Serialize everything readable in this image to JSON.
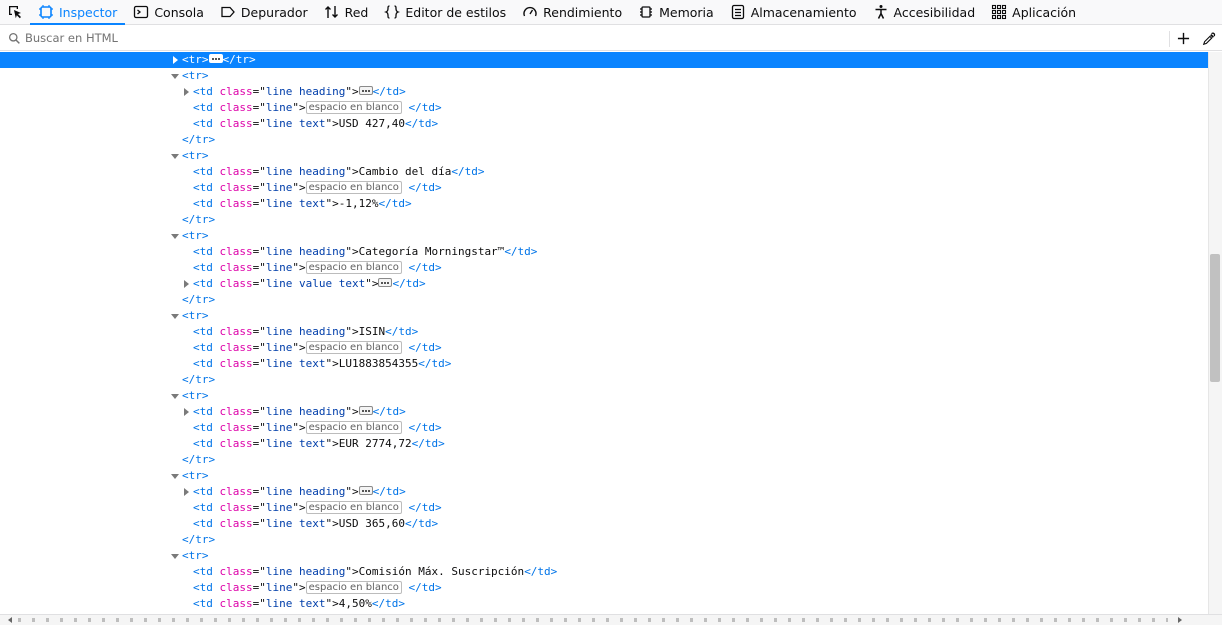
{
  "toolbar": {
    "tabs": [
      {
        "label": "Inspector",
        "icon": "inspector-icon",
        "selected": true
      },
      {
        "label": "Consola",
        "icon": "console-icon"
      },
      {
        "label": "Depurador",
        "icon": "debugger-icon"
      },
      {
        "label": "Red",
        "icon": "network-icon"
      },
      {
        "label": "Editor de estilos",
        "icon": "style-editor-icon"
      },
      {
        "label": "Rendimiento",
        "icon": "performance-icon"
      },
      {
        "label": "Memoria",
        "icon": "memory-icon"
      },
      {
        "label": "Almacenamiento",
        "icon": "storage-icon"
      },
      {
        "label": "Accesibilidad",
        "icon": "accessibility-icon"
      },
      {
        "label": "Aplicación",
        "icon": "application-icon"
      }
    ],
    "accent_color": "#0a84ff"
  },
  "search": {
    "placeholder": "Buscar en HTML"
  },
  "markup": {
    "whitespace_label": "espacio en blanco",
    "colors": {
      "tag": "#0074e8",
      "attr_name": "#dd00a9",
      "attr_value": "#003eaa",
      "selection": "#0a84ff"
    },
    "nodes": [
      {
        "kind": "tr_collapsed",
        "depth": 0,
        "selected": true
      },
      {
        "kind": "tr_open",
        "depth": 0
      },
      {
        "kind": "td",
        "depth": 1,
        "cls": "line heading",
        "content": "",
        "collapsed": true
      },
      {
        "kind": "td_ws",
        "depth": 1,
        "cls": "line"
      },
      {
        "kind": "td",
        "depth": 1,
        "cls": "line text",
        "content": "USD 427,40"
      },
      {
        "kind": "tr_close",
        "depth": 0
      },
      {
        "kind": "tr_open",
        "depth": 0
      },
      {
        "kind": "td",
        "depth": 1,
        "cls": "line heading",
        "content": "Cambio del día"
      },
      {
        "kind": "td_ws",
        "depth": 1,
        "cls": "line"
      },
      {
        "kind": "td",
        "depth": 1,
        "cls": "line text",
        "content": "-1,12%"
      },
      {
        "kind": "tr_close",
        "depth": 0
      },
      {
        "kind": "tr_open",
        "depth": 0
      },
      {
        "kind": "td",
        "depth": 1,
        "cls": "line heading",
        "content": "Categoría Morningstar™"
      },
      {
        "kind": "td_ws",
        "depth": 1,
        "cls": "line"
      },
      {
        "kind": "td",
        "depth": 1,
        "cls": "line value text",
        "content": "",
        "collapsed": true
      },
      {
        "kind": "tr_close",
        "depth": 0
      },
      {
        "kind": "tr_open",
        "depth": 0
      },
      {
        "kind": "td",
        "depth": 1,
        "cls": "line heading",
        "content": "ISIN"
      },
      {
        "kind": "td_ws",
        "depth": 1,
        "cls": "line"
      },
      {
        "kind": "td",
        "depth": 1,
        "cls": "line text",
        "content": "LU1883854355"
      },
      {
        "kind": "tr_close",
        "depth": 0
      },
      {
        "kind": "tr_open",
        "depth": 0
      },
      {
        "kind": "td",
        "depth": 1,
        "cls": "line heading",
        "content": "",
        "collapsed": true
      },
      {
        "kind": "td_ws",
        "depth": 1,
        "cls": "line"
      },
      {
        "kind": "td",
        "depth": 1,
        "cls": "line text",
        "content": "EUR 2774,72"
      },
      {
        "kind": "tr_close",
        "depth": 0
      },
      {
        "kind": "tr_open",
        "depth": 0
      },
      {
        "kind": "td",
        "depth": 1,
        "cls": "line heading",
        "content": "",
        "collapsed": true
      },
      {
        "kind": "td_ws",
        "depth": 1,
        "cls": "line"
      },
      {
        "kind": "td",
        "depth": 1,
        "cls": "line text",
        "content": "USD 365,60"
      },
      {
        "kind": "tr_close",
        "depth": 0
      },
      {
        "kind": "tr_open",
        "depth": 0
      },
      {
        "kind": "td",
        "depth": 1,
        "cls": "line heading",
        "content": "Comisión Máx. Suscripción"
      },
      {
        "kind": "td_ws",
        "depth": 1,
        "cls": "line"
      },
      {
        "kind": "td",
        "depth": 1,
        "cls": "line text",
        "content": "4,50%"
      }
    ]
  }
}
